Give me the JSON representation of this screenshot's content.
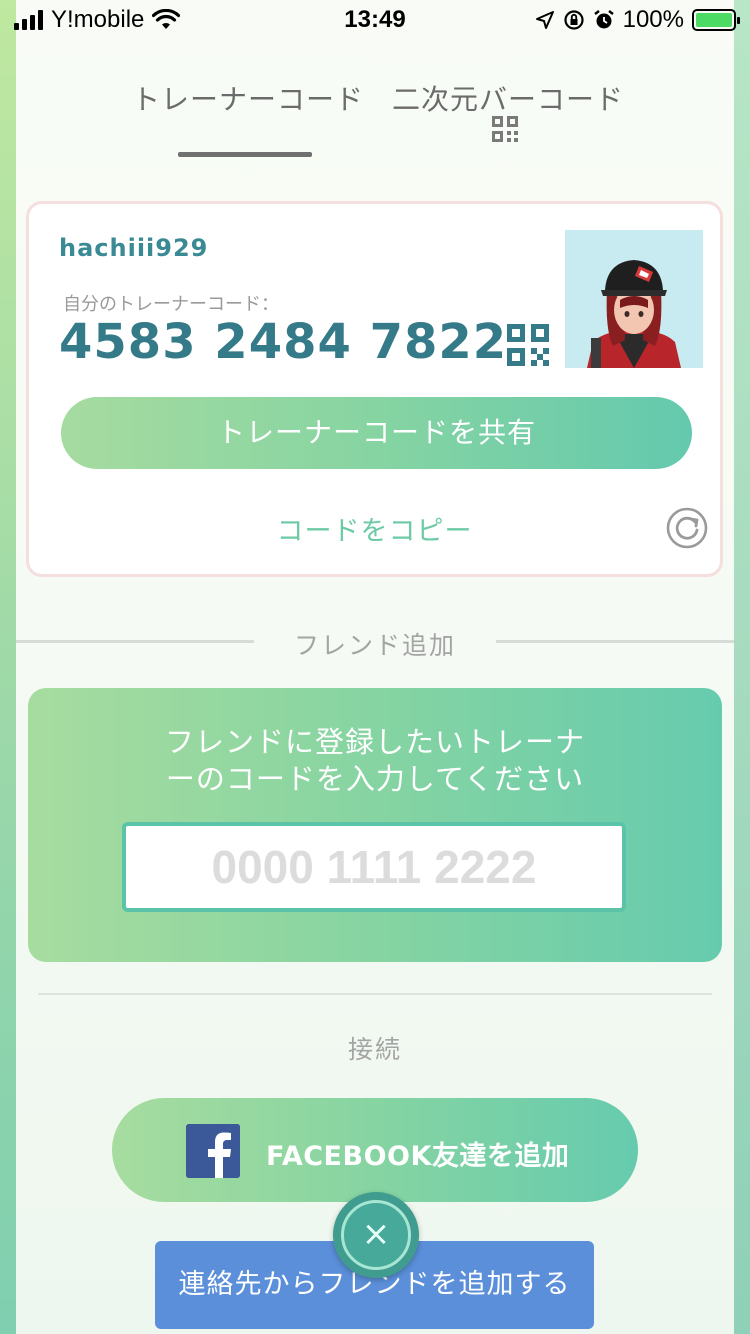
{
  "status_bar": {
    "carrier": "Y!mobile",
    "time": "13:49",
    "battery": "100%"
  },
  "tabs": {
    "trainer_code": "トレーナーコード",
    "qr_code": "二次元バーコード"
  },
  "profile": {
    "username": "hachiii929",
    "code_label": "自分のトレーナーコード：",
    "trainer_code": "4583 2484 7822",
    "share_button": "トレーナーコードを共有",
    "copy_link": "コードをコピー"
  },
  "friend_add": {
    "section_label": "フレンド追加",
    "instruction_line1": "フレンドに登録したいトレーナ",
    "instruction_line2": "ーのコードを入力してください",
    "input_placeholder": "0000 1111 2222",
    "input_value": ""
  },
  "connect": {
    "section_label": "接続",
    "facebook_button": "FACEBOOK友達を追加",
    "contacts_button": "連絡先からフレンドを追加する",
    "close_symbol": "×"
  },
  "colors": {
    "accent_teal": "#347a88",
    "button_gradient_start": "#a6dba0",
    "button_gradient_end": "#64c9ae",
    "facebook_blue": "#3b5998",
    "contacts_blue": "#5b8fd9",
    "close_button": "#3f9c8f"
  },
  "icons": [
    "wifi-icon",
    "location-arrow-icon",
    "rotation-lock-icon",
    "alarm-icon",
    "battery-icon",
    "qr-code-icon",
    "refresh-icon",
    "facebook-icon",
    "close-icon"
  ]
}
